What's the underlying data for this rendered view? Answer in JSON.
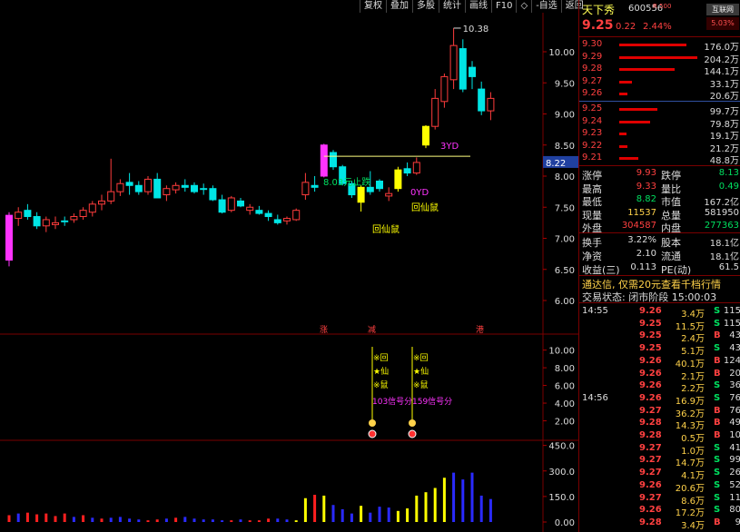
{
  "toolbar": {
    "items": [
      "复权",
      "叠加",
      "多股",
      "统计",
      "画线",
      "F10",
      "◇",
      "-自选",
      "返回"
    ]
  },
  "colors": {
    "up": "#ff3c3c",
    "down": "#00e5e5",
    "magenta": "#ff33ff",
    "yellow": "#ffff00",
    "blue": "#2a2aff"
  },
  "chart_data": [
    {
      "type": "candlestick",
      "title": "",
      "y_ticks": [
        "10.00",
        "9.50",
        "9.00",
        "8.50",
        "8.00",
        "7.50",
        "7.00",
        "6.50",
        "6.00"
      ],
      "ylim": [
        6.0,
        10.6
      ],
      "last_price_tag": "8.22",
      "high_annotation": "10.38",
      "reference_line_level": 8.32,
      "candles": [
        {
          "o": 6.65,
          "h": 7.42,
          "l": 6.55,
          "c": 7.37,
          "color": "magenta"
        },
        {
          "o": 7.32,
          "h": 7.5,
          "l": 7.2,
          "c": 7.42,
          "color": "up"
        },
        {
          "o": 7.45,
          "h": 7.55,
          "l": 7.3,
          "c": 7.35,
          "color": "down"
        },
        {
          "o": 7.35,
          "h": 7.42,
          "l": 7.15,
          "c": 7.2,
          "color": "down"
        },
        {
          "o": 7.2,
          "h": 7.35,
          "l": 7.1,
          "c": 7.3,
          "color": "up"
        },
        {
          "o": 7.25,
          "h": 7.35,
          "l": 7.15,
          "c": 7.22,
          "color": "up"
        },
        {
          "o": 7.28,
          "h": 7.35,
          "l": 7.2,
          "c": 7.28,
          "color": "down"
        },
        {
          "o": 7.3,
          "h": 7.4,
          "l": 7.25,
          "c": 7.35,
          "color": "up"
        },
        {
          "o": 7.35,
          "h": 7.5,
          "l": 7.3,
          "c": 7.45,
          "color": "up"
        },
        {
          "o": 7.42,
          "h": 7.6,
          "l": 7.35,
          "c": 7.55,
          "color": "up"
        },
        {
          "o": 7.55,
          "h": 7.7,
          "l": 7.45,
          "c": 7.6,
          "color": "up"
        },
        {
          "o": 7.6,
          "h": 8.28,
          "l": 7.55,
          "c": 7.75,
          "color": "up"
        },
        {
          "o": 7.75,
          "h": 7.95,
          "l": 7.68,
          "c": 7.88,
          "color": "up"
        },
        {
          "o": 7.9,
          "h": 8.05,
          "l": 7.7,
          "c": 7.85,
          "color": "down"
        },
        {
          "o": 7.85,
          "h": 7.92,
          "l": 7.7,
          "c": 7.75,
          "color": "down"
        },
        {
          "o": 7.75,
          "h": 8.0,
          "l": 7.7,
          "c": 7.95,
          "color": "up"
        },
        {
          "o": 7.95,
          "h": 8.05,
          "l": 7.65,
          "c": 7.65,
          "color": "down"
        },
        {
          "o": 7.7,
          "h": 7.85,
          "l": 7.6,
          "c": 7.8,
          "color": "up"
        },
        {
          "o": 7.78,
          "h": 7.9,
          "l": 7.72,
          "c": 7.85,
          "color": "up"
        },
        {
          "o": 7.82,
          "h": 7.95,
          "l": 7.75,
          "c": 7.85,
          "color": "down"
        },
        {
          "o": 7.85,
          "h": 7.9,
          "l": 7.72,
          "c": 7.75,
          "color": "down"
        },
        {
          "o": 7.8,
          "h": 7.88,
          "l": 7.7,
          "c": 7.8,
          "color": "down"
        },
        {
          "o": 7.8,
          "h": 7.85,
          "l": 7.6,
          "c": 7.62,
          "color": "down"
        },
        {
          "o": 7.62,
          "h": 7.7,
          "l": 7.4,
          "c": 7.42,
          "color": "down"
        },
        {
          "o": 7.45,
          "h": 7.68,
          "l": 7.42,
          "c": 7.65,
          "color": "up"
        },
        {
          "o": 7.6,
          "h": 7.65,
          "l": 7.5,
          "c": 7.52,
          "color": "down"
        },
        {
          "o": 7.45,
          "h": 7.55,
          "l": 7.38,
          "c": 7.5,
          "color": "up"
        },
        {
          "o": 7.45,
          "h": 7.52,
          "l": 7.38,
          "c": 7.4,
          "color": "down"
        },
        {
          "o": 7.4,
          "h": 7.45,
          "l": 7.28,
          "c": 7.35,
          "color": "down"
        },
        {
          "o": 7.3,
          "h": 7.38,
          "l": 7.22,
          "c": 7.25,
          "color": "down"
        },
        {
          "o": 7.28,
          "h": 7.35,
          "l": 7.22,
          "c": 7.32,
          "color": "up"
        },
        {
          "o": 7.3,
          "h": 7.48,
          "l": 7.28,
          "c": 7.45,
          "color": "up"
        },
        {
          "o": 7.7,
          "h": 8.05,
          "l": 7.62,
          "c": 7.9,
          "color": "up"
        },
        {
          "o": 7.85,
          "h": 8.0,
          "l": 7.75,
          "c": 7.82,
          "color": "down"
        },
        {
          "o": 8.0,
          "h": 8.52,
          "l": 7.98,
          "c": 8.5,
          "color": "magenta"
        },
        {
          "o": 8.38,
          "h": 8.42,
          "l": 8.1,
          "c": 8.15,
          "color": "down"
        },
        {
          "o": 8.15,
          "h": 8.18,
          "l": 7.85,
          "c": 7.88,
          "color": "down"
        },
        {
          "o": 7.88,
          "h": 7.92,
          "l": 7.65,
          "c": 7.7,
          "color": "down"
        },
        {
          "o": 7.58,
          "h": 7.85,
          "l": 7.43,
          "c": 7.82,
          "color": "yellow"
        },
        {
          "o": 7.82,
          "h": 8.08,
          "l": 7.7,
          "c": 7.75,
          "color": "down"
        },
        {
          "o": 7.8,
          "h": 7.95,
          "l": 7.75,
          "c": 7.92,
          "color": "down"
        },
        {
          "o": 7.68,
          "h": 7.82,
          "l": 7.6,
          "c": 7.72,
          "color": "up"
        },
        {
          "o": 7.8,
          "h": 8.15,
          "l": 7.75,
          "c": 8.1,
          "color": "yellow"
        },
        {
          "o": 8.05,
          "h": 8.22,
          "l": 8.0,
          "c": 8.12,
          "color": "down"
        },
        {
          "o": 8.05,
          "h": 8.3,
          "l": 8.02,
          "c": 8.22,
          "color": "up"
        },
        {
          "o": 8.5,
          "h": 8.82,
          "l": 8.45,
          "c": 8.8,
          "color": "yellow"
        },
        {
          "o": 8.8,
          "h": 9.4,
          "l": 8.75,
          "c": 9.25,
          "color": "up"
        },
        {
          "o": 9.2,
          "h": 9.65,
          "l": 9.1,
          "c": 9.6,
          "color": "up"
        },
        {
          "o": 9.55,
          "h": 10.38,
          "l": 9.4,
          "c": 10.1,
          "color": "up"
        },
        {
          "o": 10.05,
          "h": 10.2,
          "l": 9.35,
          "c": 9.4,
          "color": "down"
        },
        {
          "o": 9.75,
          "h": 9.85,
          "l": 9.4,
          "c": 9.6,
          "color": "down"
        },
        {
          "o": 9.4,
          "h": 9.52,
          "l": 8.98,
          "c": 9.05,
          "color": "down"
        },
        {
          "o": 9.25,
          "h": 9.35,
          "l": 8.9,
          "c": 9.05,
          "color": "up"
        }
      ],
      "annotations": {
        "limit_label": "8.03元止跌",
        "signal_1": "回仙鼠",
        "signal_2": "回仙鼠",
        "yd_1": "3YD",
        "yd_2": "0YD",
        "markers": [
          "涨",
          "减",
          "港"
        ]
      }
    },
    {
      "type": "signal_indicator",
      "y_ticks": [
        "10.00",
        "8.00",
        "6.00",
        "4.00",
        "2.00"
      ],
      "ylim": [
        0,
        11.5
      ],
      "signals": [
        {
          "lines": [
            "※回",
            "★仙",
            "※鼠"
          ],
          "score": "103信号分"
        },
        {
          "lines": [
            "※回",
            "★仙",
            "※鼠"
          ],
          "score": "159信号分"
        }
      ]
    },
    {
      "type": "bar",
      "title": "",
      "y_ticks": [
        "450.0",
        "300.0",
        "150.0",
        "0.00"
      ],
      "ylim": [
        0,
        480
      ],
      "values": [
        40,
        50,
        55,
        45,
        50,
        35,
        50,
        30,
        40,
        25,
        20,
        25,
        30,
        20,
        15,
        10,
        15,
        20,
        25,
        30,
        20,
        15,
        15,
        10,
        10,
        15,
        10,
        10,
        20,
        20,
        15,
        10,
        140,
        160,
        155,
        100,
        75,
        50,
        95,
        55,
        90,
        85,
        65,
        80,
        155,
        175,
        200,
        260,
        290,
        250,
        290,
        155,
        135
      ],
      "colors": [
        "red",
        "blue",
        "red",
        "red",
        "red",
        "red",
        "red",
        "blue",
        "red",
        "blue",
        "red",
        "blue",
        "blue",
        "blue",
        "blue",
        "red",
        "red",
        "blue",
        "red",
        "blue",
        "blue",
        "blue",
        "blue",
        "blue",
        "red",
        "blue",
        "red",
        "red",
        "red",
        "blue",
        "blue",
        "yellow",
        "yellow",
        "red",
        "yellow",
        "blue",
        "blue",
        "blue",
        "yellow",
        "blue",
        "blue",
        "blue",
        "yellow",
        "yellow",
        "yellow",
        "yellow",
        "yellow",
        "yellow",
        "blue",
        "blue",
        "blue",
        "blue"
      ]
    }
  ],
  "quote": {
    "name": "天下秀",
    "code": "600556",
    "badge": "R 500",
    "source_btn": "互联网",
    "source_pct": "5.03%",
    "price": "9.25",
    "change": "0.22",
    "pct": "2.44%",
    "asks": [
      {
        "label": "9.30",
        "price": "9.30",
        "vol": "176.0万",
        "frac": 0.86
      },
      {
        "label": "9.29",
        "price": "9.29",
        "vol": "204.2万",
        "frac": 1.0
      },
      {
        "label": "9.28",
        "price": "9.28",
        "vol": "144.1万",
        "frac": 0.71
      },
      {
        "label": "9.27",
        "price": "9.27",
        "vol": "33.1万",
        "frac": 0.16
      },
      {
        "label": "9.26",
        "price": "9.26",
        "vol": "20.6万",
        "frac": 0.1
      }
    ],
    "bids": [
      {
        "label": "9.25",
        "price": "9.25",
        "vol": "99.7万",
        "frac": 0.49
      },
      {
        "label": "9.24",
        "price": "9.24",
        "vol": "79.8万",
        "frac": 0.39
      },
      {
        "label": "9.23",
        "price": "9.23",
        "vol": "19.1万",
        "frac": 0.09
      },
      {
        "label": "9.22",
        "price": "9.22",
        "vol": "21.2万",
        "frac": 0.1
      },
      {
        "label": "9.21",
        "price": "9.21",
        "vol": "48.8万",
        "frac": 0.24
      }
    ],
    "stats": [
      {
        "l1": "涨停",
        "v1": "9.93",
        "c1": "#ff4040",
        "l2": "跌停",
        "v2": "8.13",
        "c2": "#00e060"
      },
      {
        "l1": "最高",
        "v1": "9.33",
        "c1": "#ff4040",
        "l2": "量比",
        "v2": "0.49",
        "c2": "#00e060"
      },
      {
        "l1": "最低",
        "v1": "8.82",
        "c1": "#00e060",
        "l2": "市值",
        "v2": "167.2亿",
        "c2": "#dddddd"
      },
      {
        "l1": "现量",
        "v1": "11537",
        "c1": "#ffd24a",
        "l2": "总量",
        "v2": "581950",
        "c2": "#dddddd"
      },
      {
        "l1": "外盘",
        "v1": "304587",
        "c1": "#ff4040",
        "l2": "内盘",
        "v2": "277363",
        "c2": "#00e060"
      }
    ],
    "stats2": [
      {
        "l1": "换手",
        "v1": "3.22%",
        "l2": "股本",
        "v2": "18.1亿"
      },
      {
        "l1": "净资",
        "v1": "2.10",
        "l2": "流通",
        "v2": "18.1亿"
      },
      {
        "l1": "收益(三)",
        "v1": "0.113",
        "l2": "PE(动)",
        "v2": "61.5"
      }
    ],
    "notice": "通达信, 仅需20元查看千档行情",
    "trade_state": "交易状态: 闭市阶段  15:00:03",
    "ticks": [
      {
        "t": "14:55",
        "p": "9.26",
        "v": "3.4万",
        "bs": "S",
        "n": "115"
      },
      {
        "t": "",
        "p": "9.25",
        "v": "11.5万",
        "bs": "S",
        "n": "115"
      },
      {
        "t": "",
        "p": "9.25",
        "v": "2.4万",
        "bs": "B",
        "n": "43"
      },
      {
        "t": "",
        "p": "9.25",
        "v": "5.1万",
        "bs": "S",
        "n": "43"
      },
      {
        "t": "",
        "p": "9.26",
        "v": "40.1万",
        "bs": "B",
        "n": "124"
      },
      {
        "t": "",
        "p": "9.26",
        "v": "2.1万",
        "bs": "B",
        "n": "20"
      },
      {
        "t": "",
        "p": "9.26",
        "v": "2.2万",
        "bs": "S",
        "n": "36"
      },
      {
        "t": "14:56",
        "p": "9.26",
        "v": "16.9万",
        "bs": "S",
        "n": "76"
      },
      {
        "t": "",
        "p": "9.27",
        "v": "36.2万",
        "bs": "B",
        "n": "76"
      },
      {
        "t": "",
        "p": "9.28",
        "v": "14.3万",
        "bs": "B",
        "n": "49"
      },
      {
        "t": "",
        "p": "9.28",
        "v": "0.5万",
        "bs": "B",
        "n": "10"
      },
      {
        "t": "",
        "p": "9.27",
        "v": "1.0万",
        "bs": "S",
        "n": "41"
      },
      {
        "t": "",
        "p": "9.27",
        "v": "14.7万",
        "bs": "S",
        "n": "99"
      },
      {
        "t": "",
        "p": "9.27",
        "v": "4.1万",
        "bs": "S",
        "n": "26"
      },
      {
        "t": "",
        "p": "9.26",
        "v": "20.6万",
        "bs": "S",
        "n": "52"
      },
      {
        "t": "",
        "p": "9.27",
        "v": "8.6万",
        "bs": "S",
        "n": "11"
      },
      {
        "t": "",
        "p": "9.26",
        "v": "17.2万",
        "bs": "S",
        "n": "80"
      },
      {
        "t": "",
        "p": "9.28",
        "v": "3.4万",
        "bs": "B",
        "n": "9"
      }
    ]
  }
}
